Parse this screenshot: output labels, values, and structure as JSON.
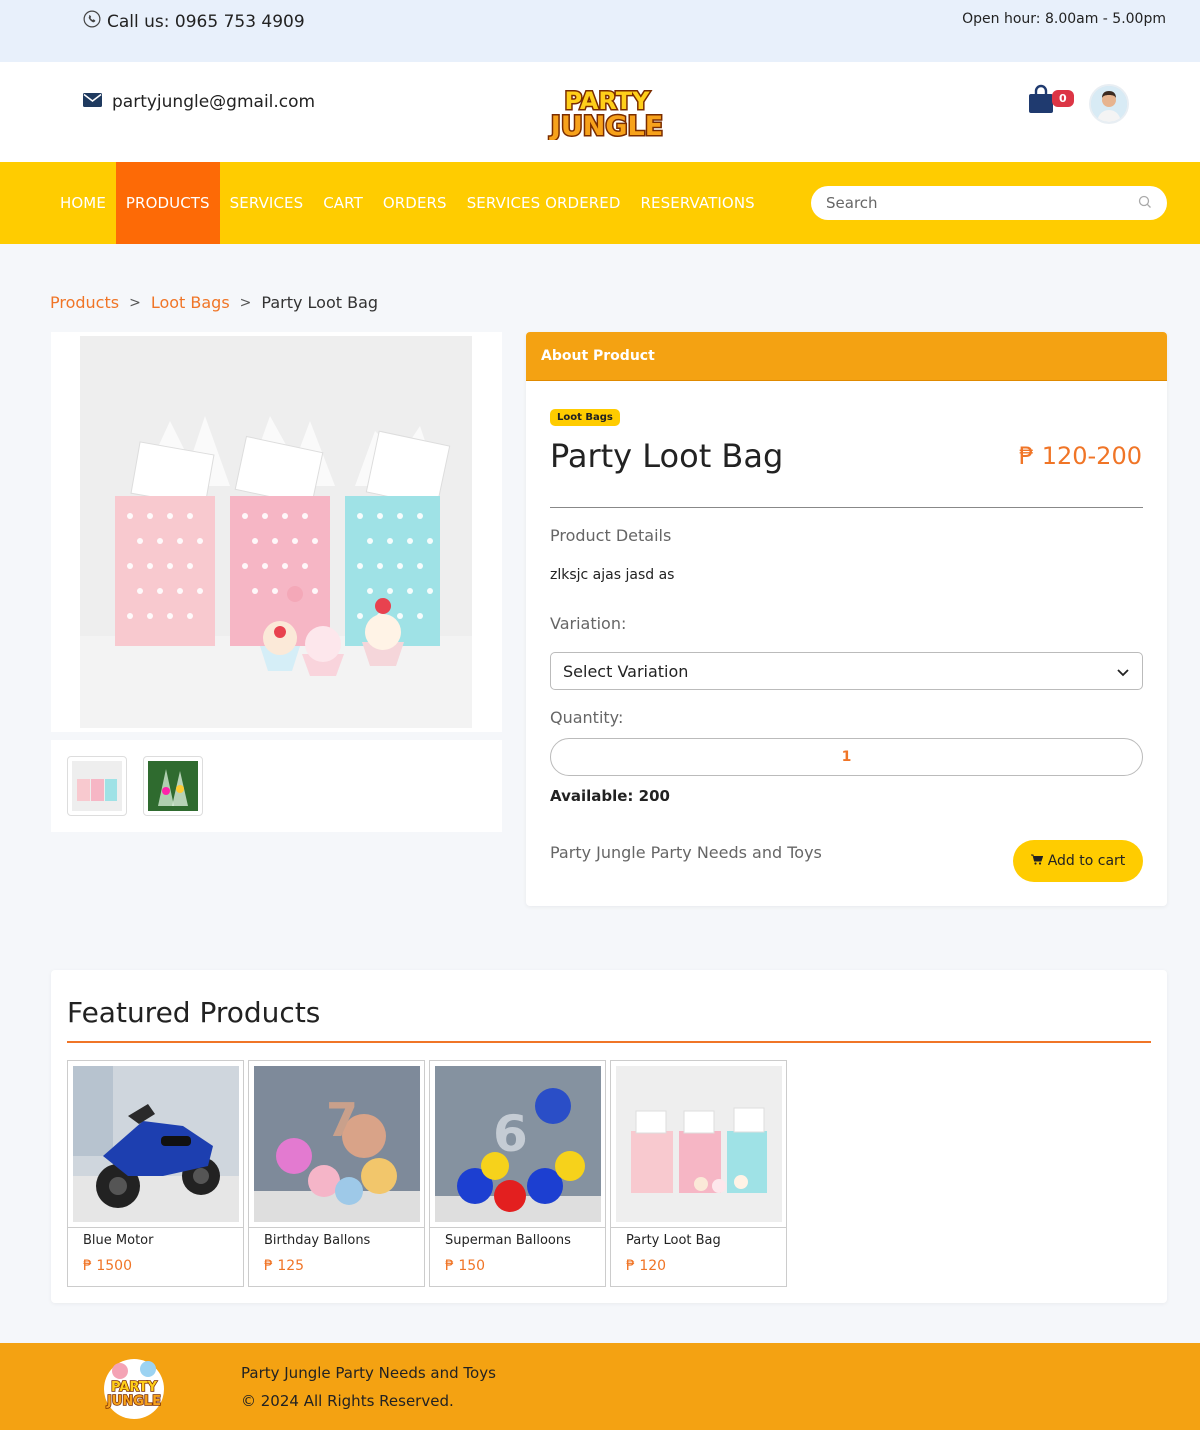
{
  "topbar": {
    "phone": "Call us: 0965 753 4909",
    "hours": "Open hour: 8.00am - 5.00pm"
  },
  "header": {
    "email": "partyjungle@gmail.com",
    "logo_text_top": "PARTY",
    "logo_text_bottom": "JUNGLE",
    "cart_count": "0"
  },
  "nav": {
    "items": [
      {
        "label": "HOME",
        "active": false
      },
      {
        "label": "PRODUCTS",
        "active": true
      },
      {
        "label": "SERVICES",
        "active": false
      },
      {
        "label": "CART",
        "active": false
      },
      {
        "label": "ORDERS",
        "active": false
      },
      {
        "label": "SERVICES ORDERED",
        "active": false
      },
      {
        "label": "RESERVATIONS",
        "active": false
      }
    ],
    "search_placeholder": "Search"
  },
  "breadcrumb": {
    "items": [
      "Products",
      "Loot Bags",
      "Party Loot Bag"
    ]
  },
  "product": {
    "section_header": "About Product",
    "category": "Loot Bags",
    "title": "Party Loot Bag",
    "price": "₱ 120-200",
    "details_label": "Product Details",
    "details": "zlksjc ajas jasd as",
    "variation_label": "Variation:",
    "variation_selected": "Select Variation",
    "quantity_label": "Quantity:",
    "quantity": "1",
    "available": "Available: 200",
    "shop_name": "Party Jungle Party Needs and Toys",
    "add_to_cart": "Add to cart"
  },
  "featured": {
    "title": "Featured Products",
    "items": [
      {
        "name": "Blue Motor",
        "price": "₱ 1500"
      },
      {
        "name": "Birthday Ballons",
        "price": "₱ 125"
      },
      {
        "name": "Superman Balloons",
        "price": "₱ 150"
      },
      {
        "name": "Party Loot Bag",
        "price": "₱ 120"
      }
    ]
  },
  "footer": {
    "name": "Party Jungle Party Needs and Toys",
    "copyright": "© 2024 All Rights Reserved."
  },
  "colors": {
    "accent_orange": "#f07527",
    "nav_yellow": "#ffcc00",
    "header_orange": "#f4a212",
    "active_nav": "#fd6a06"
  }
}
